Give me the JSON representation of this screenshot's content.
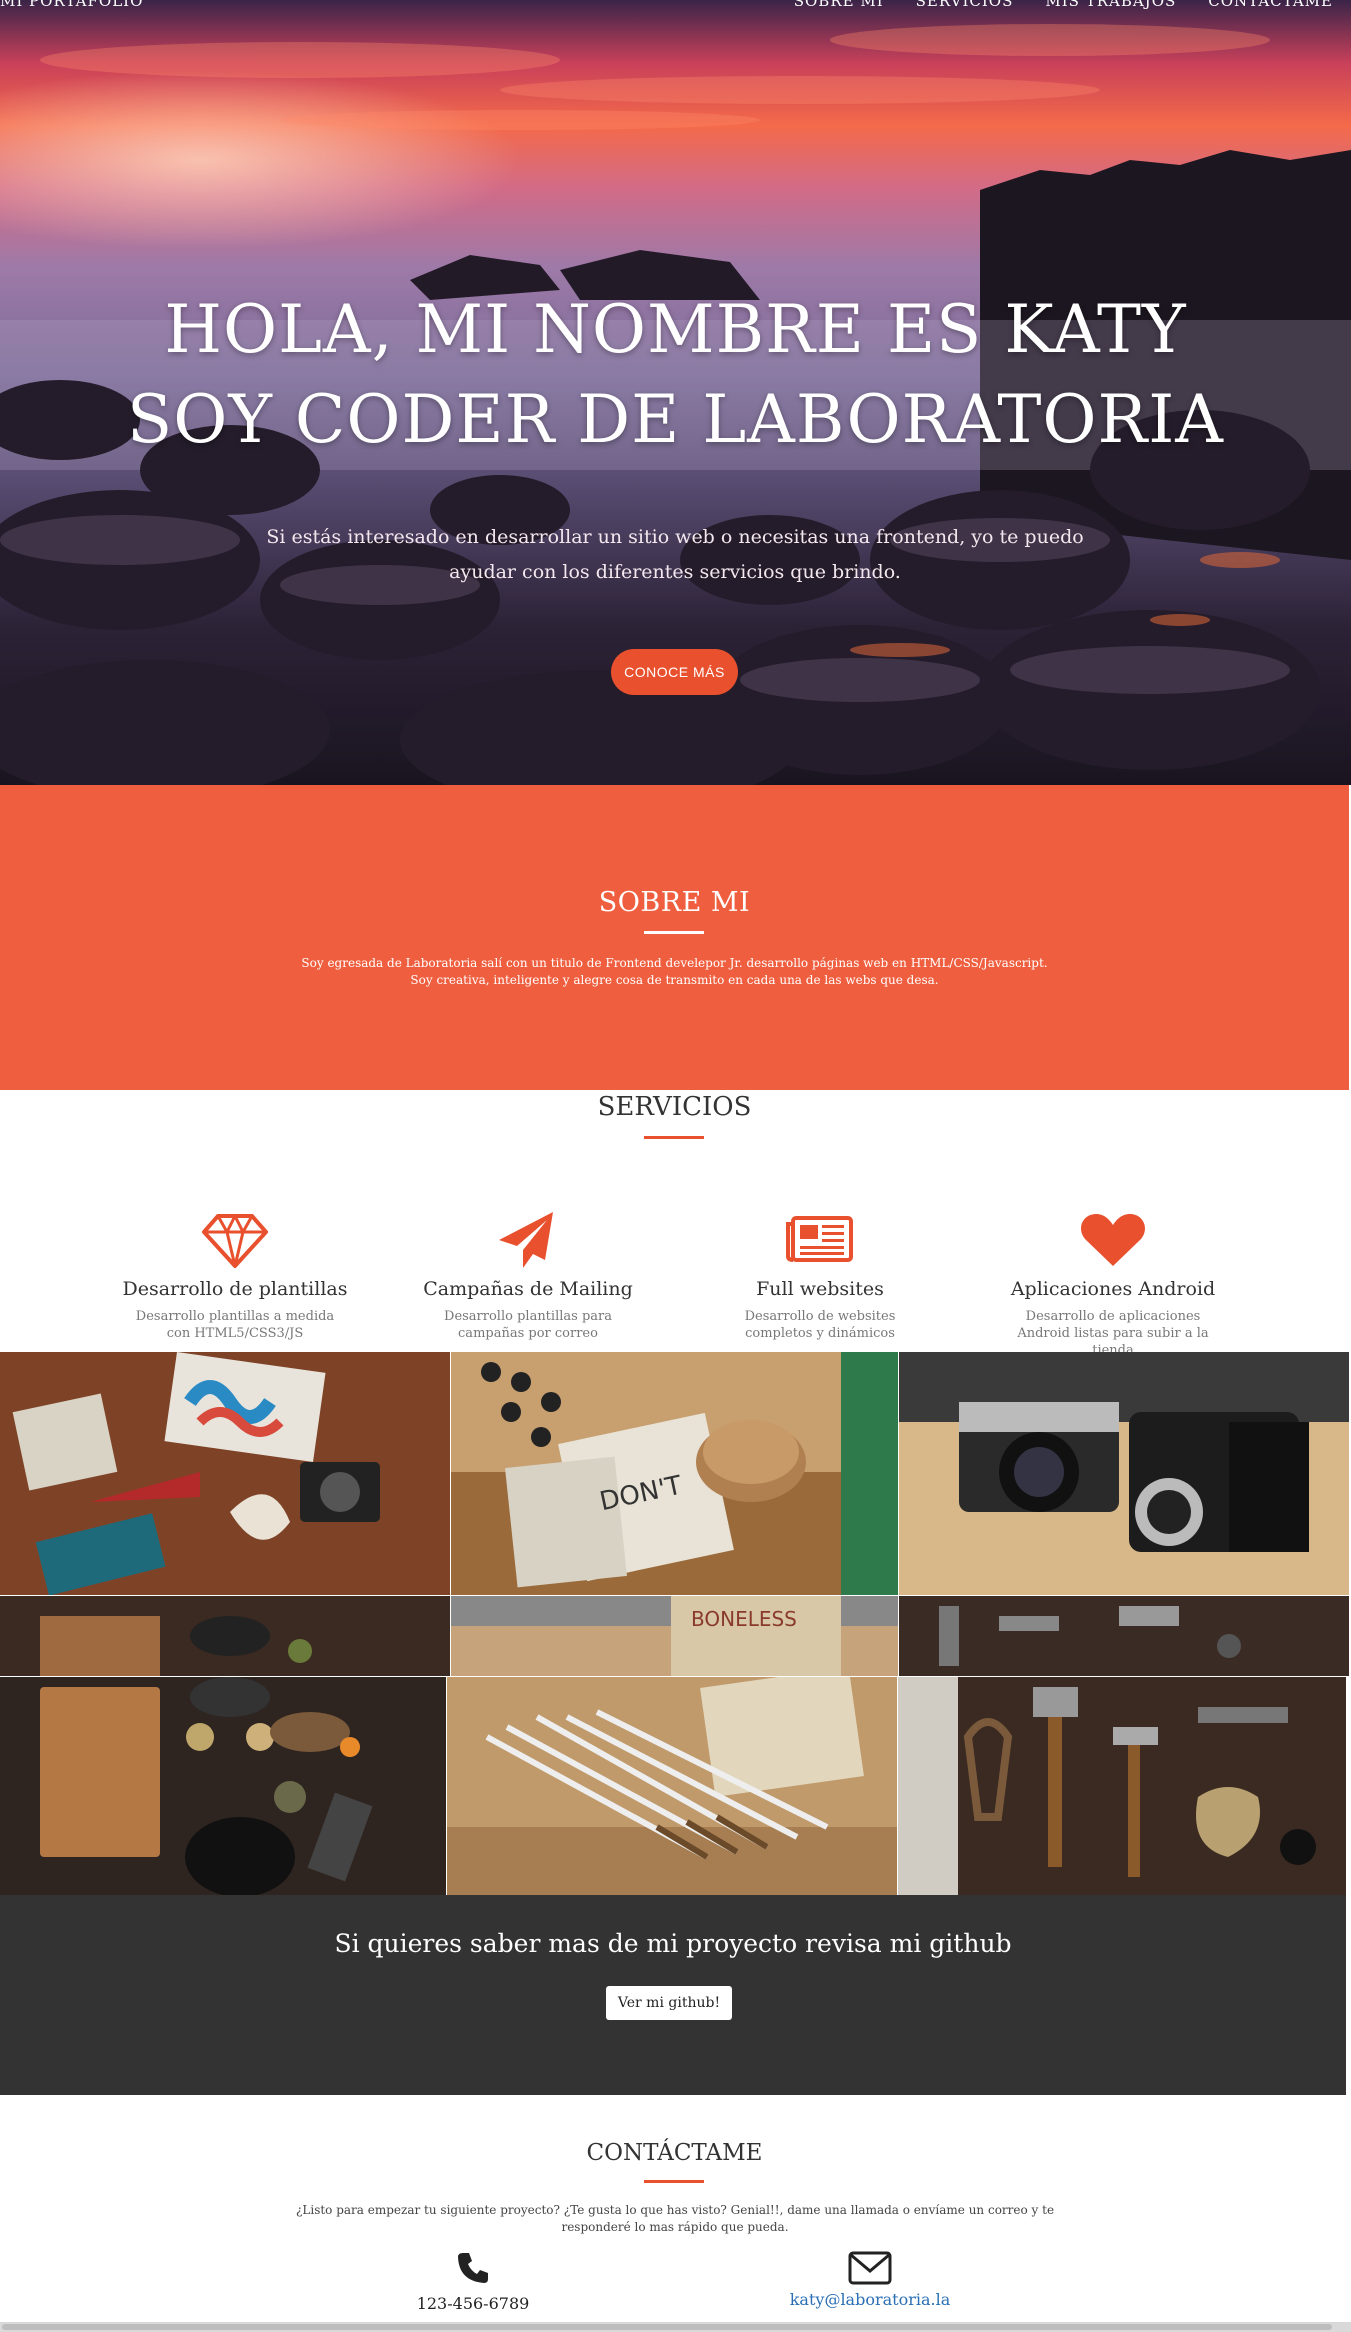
{
  "nav": {
    "brand": "MI PORTAFOLIO",
    "links": [
      "SOBRE MI",
      "SERVICIOS",
      "MIS TRABAJOS",
      "CONTÁCTAME"
    ]
  },
  "hero": {
    "title_line1": "HOLA, MI NOMBRE ES KATY",
    "title_line2": "SOY CODER DE LABORATORIA",
    "subtitle": "Si estás interesado en desarrollar un sitio web o necesitas una frontend, yo te puedo ayudar con los diferentes servicios que brindo.",
    "button": "CONOCE MÁS"
  },
  "about": {
    "title": "SOBRE MI",
    "line1": "Soy egresada de Laboratoria salí con un titulo de Frontend develepor Jr. desarrollo páginas web en HTML/CSS/Javascript.",
    "line2": "Soy creativa, inteligente y alegre cosa de transmito en cada una de las webs que desa."
  },
  "services": {
    "title": "SERVICIOS",
    "items": [
      {
        "icon": "diamond-icon",
        "title": "Desarrollo de plantillas",
        "desc": "Desarrollo plantillas a medida con HTML5/CSS3/JS"
      },
      {
        "icon": "paper-plane-icon",
        "title": "Campañas de Mailing",
        "desc": "Desarrollo plantillas para campañas por correo"
      },
      {
        "icon": "newspaper-icon",
        "title": "Full websites",
        "desc": "Desarrollo de websites completos y dinámicos"
      },
      {
        "icon": "heart-icon",
        "title": "Aplicaciones Android",
        "desc": "Desarrollo de aplicaciones Android listas para subir a la tienda"
      }
    ]
  },
  "github": {
    "title": "Si quieres saber mas de mi proyecto revisa mi github",
    "button": "Ver mi github!"
  },
  "contact": {
    "title": "CONTÁCTAME",
    "text": "¿Listo para empezar tu siguiente proyecto? ¿Te gusta lo que has visto? Genial!!, dame una llamada o envíame un correo y te responderé lo mas rápido que pueda.",
    "phone": "123-456-6789",
    "email": "katy@laboratoria.la"
  },
  "colors": {
    "accent": "#e8502e",
    "about_bg": "#ef5f3f",
    "dark_bg": "#333333"
  }
}
